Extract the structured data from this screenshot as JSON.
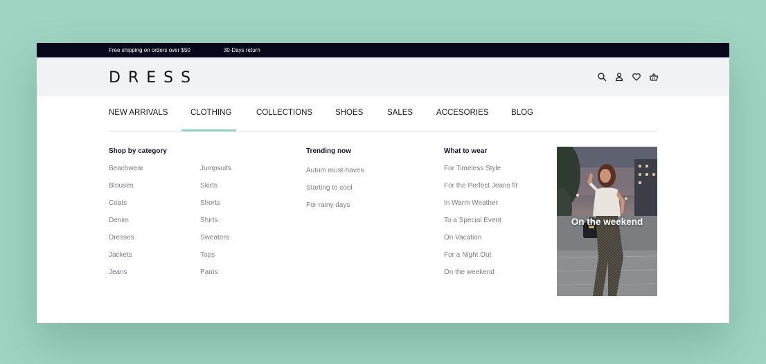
{
  "topbar": {
    "promo_shipping": "Free shipping  on orders over $50",
    "promo_returns": "30-Days return"
  },
  "header": {
    "logo": "DRESS",
    "icons": [
      "search-icon",
      "user-icon",
      "heart-icon",
      "basket-icon"
    ]
  },
  "nav": {
    "items": [
      "NEW ARRIVALS",
      "CLOTHING",
      "COLLECTIONS",
      "SHOES",
      "SALES",
      "ACCESORIES",
      "BLOG"
    ],
    "active": "CLOTHING",
    "accent": "#8ed2bf"
  },
  "menu": {
    "shop_by_category": {
      "title": "Shop by category",
      "col1": [
        "Beachwear",
        "Blouses",
        "Coats",
        "Denim",
        "Dresses",
        "Jackets",
        "Jeans"
      ],
      "col2": [
        "Jumpsuits",
        "Skirts",
        "Shorts",
        "Shirts",
        "Sweaters",
        "Tops",
        "Pants"
      ]
    },
    "trending": {
      "title": "Trending now",
      "items": [
        "Autum must-haves",
        "Starting to cool",
        "For rainy days"
      ]
    },
    "what_to_wear": {
      "title": "What  to wear",
      "items": [
        "For Timeless Style",
        "For the Perfect Jeans fit",
        "In Warm Weather",
        "To a Special Event",
        "On Vacation",
        "For a Night Out",
        "On the weekend"
      ]
    },
    "promo": {
      "caption": "On the weekend"
    }
  },
  "colors": {
    "background": "#9fd4c2",
    "topbar": "#06071a",
    "header": "#f1f2f5",
    "accent": "#8ed2bf"
  }
}
